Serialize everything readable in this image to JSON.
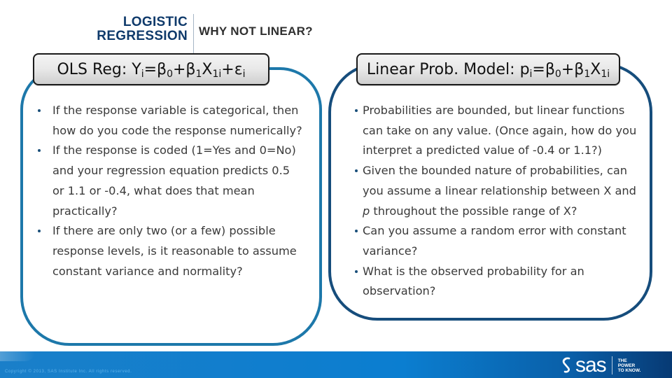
{
  "header": {
    "section_line1": "LOGISTIC",
    "section_line2": "REGRESSION",
    "title": "WHY NOT LINEAR?"
  },
  "left_panel": {
    "title_label": "OLS Reg: ",
    "equation": {
      "lhs": "Y",
      "lhs_sub": "i",
      "eq": "=",
      "b0": "β",
      "b0_sub": "0",
      "plus1": "+",
      "b1": "β",
      "b1_sub": "1",
      "x": "X",
      "x_sub": "1i",
      "plus2": "+",
      "err": "ε",
      "err_sub": "i"
    },
    "bullets": [
      "If the response variable is categorical, then how do you code the response numerically?",
      "If the response is coded (1=Yes and 0=No) and your regression equation predicts 0.5 or 1.1 or -0.4, what does that mean practically?",
      "If there are only two (or a few) possible response levels, is it reasonable to assume constant variance and normality?"
    ]
  },
  "right_panel": {
    "title_label": "Linear Prob. Model: ",
    "equation": {
      "lhs": "p",
      "lhs_sub": "i",
      "eq": "=",
      "b0": "β",
      "b0_sub": "0",
      "plus1": "+",
      "b1": "β",
      "b1_sub": "1",
      "x": "X",
      "x_sub": "1i"
    },
    "bullets": [
      {
        "text": "Probabilities are bounded, but linear functions can take on any value. (Once again, how do you interpret a predicted value of -0.4 or 1.1?)"
      },
      {
        "pre": "Given the bounded nature of probabilities, can you assume a linear relationship between X and ",
        "italic": "p",
        "post": " throughout the possible range of X?"
      },
      {
        "text": "Can you assume a random error with constant variance?"
      },
      {
        "text": "What is the observed probability for an observation?"
      }
    ]
  },
  "footer": {
    "copyright": "Copyright © 2013, SAS Institute Inc. All rights reserved.",
    "logo_word": "sas",
    "logo_icon": "sas-s-mark-icon",
    "tagline": "THE\nPOWER\nTO KNOW."
  },
  "colors": {
    "header_section": "#0f3a6b",
    "left_border": "#1d78aa",
    "right_border": "#164d7c",
    "footer_blue": "#0b7ed0",
    "bullet_dot": "#1a4f7a"
  }
}
